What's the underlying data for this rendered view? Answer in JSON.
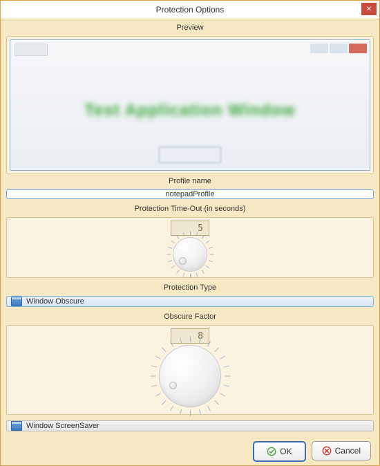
{
  "window": {
    "title": "Protection Options"
  },
  "preview": {
    "label": "Preview",
    "sample_text": "Test Application Window"
  },
  "profile": {
    "label": "Profile name",
    "value": "notepadProfile"
  },
  "timeout": {
    "label": "Protection Time-Out (in seconds)",
    "value": "5"
  },
  "protection_type": {
    "label": "Protection Type",
    "options": [
      {
        "label": "Window Obscure",
        "selected": true
      },
      {
        "label": "Window ScreenSaver",
        "selected": false
      }
    ]
  },
  "obscure": {
    "label": "Obscure Factor",
    "value": "8"
  },
  "buttons": {
    "ok": "OK",
    "cancel": "Cancel"
  },
  "colors": {
    "accent": "#3b6db5",
    "frame": "#e2a13a",
    "ok_icon": "#4aa53f",
    "cancel_icon": "#c0392b"
  }
}
